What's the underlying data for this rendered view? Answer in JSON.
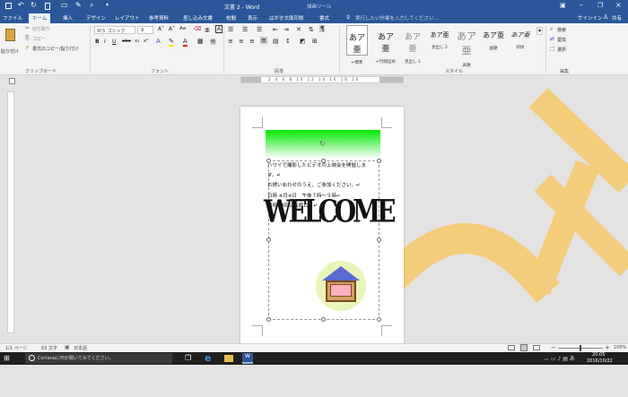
{
  "window": {
    "title": "文書 2 - Word",
    "context_tool": "描画ツール",
    "tell_me": "実行したい作業を入力してください...",
    "sign_in": "サインイン",
    "share": "共有"
  },
  "tabs": [
    "ファイル",
    "ホーム",
    "挿入",
    "デザイン",
    "レイアウト",
    "参考資料",
    "差し込み文書",
    "校閲",
    "表示",
    "はがき文面印刷",
    "書式"
  ],
  "active_tab": "ホーム",
  "clipboard": {
    "paste": "貼り付け",
    "cut": "切り取り",
    "copy": "コピー",
    "format_painter": "書式のコピー/貼り付け",
    "group_label": "クリップボード"
  },
  "font": {
    "name": "ＭＳ ゴシック",
    "size": "9",
    "group_label": "フォント"
  },
  "paragraph": {
    "group_label": "段落"
  },
  "styles": {
    "items": [
      {
        "preview": "あア亜",
        "name": "↵標準"
      },
      {
        "preview": "あア亜",
        "name": "↵行間詰め"
      },
      {
        "preview": "あア亜",
        "name": "見出し 1"
      },
      {
        "preview": "あア亜",
        "name": "見出し 2"
      },
      {
        "preview": "あア亜",
        "name": "表題"
      },
      {
        "preview": "あア亜",
        "name": "副題"
      },
      {
        "preview": "あア亜",
        "name": "斜体"
      }
    ],
    "group_label": "スタイル"
  },
  "editing": {
    "find": "検索",
    "replace": "置換",
    "select": "選択",
    "group_label": "編集"
  },
  "document": {
    "lines": [
      "ハワイで撮影したビデオの上映会を開催しま",
      "す。↵",
      "お誘いあわせのうえ、ご参加ください。↵",
      "日時 ※月※日　午後７時〜９時↵",
      "場所 中田公会館にて↵"
    ],
    "wordart": "WELCOME"
  },
  "status": {
    "page": "1/1 ページ",
    "words": "63 文字",
    "language": "日本語",
    "zoom": "100%"
  },
  "taskbar": {
    "cortana": "Cortanaに何か聞いてみてください。",
    "time": "20:05",
    "date": "2016/10/22"
  }
}
